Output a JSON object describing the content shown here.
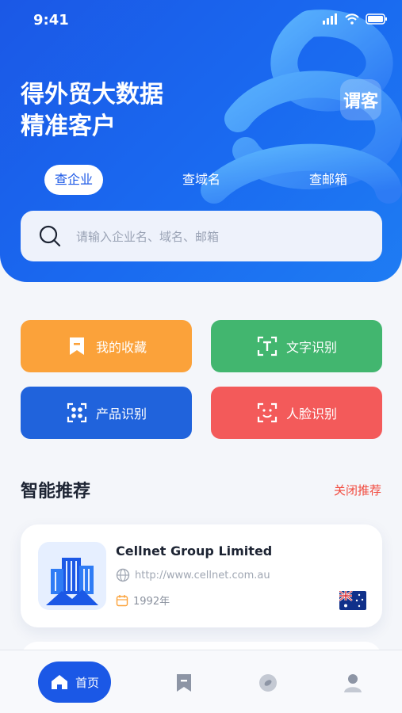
{
  "status": {
    "time": "9:41"
  },
  "hero": {
    "headline_line1": "得外贸大数据",
    "headline_line2": "精准客户",
    "brand_badge": "谓客"
  },
  "search_tabs": [
    {
      "label": "查企业",
      "active": true
    },
    {
      "label": "查域名",
      "active": false
    },
    {
      "label": "查邮箱",
      "active": false
    }
  ],
  "search": {
    "placeholder": "请输入企业名、域名、邮箱",
    "icon": "search-icon"
  },
  "features": [
    {
      "label": "我的收藏",
      "icon": "bookmark-icon",
      "color": "#fba23a"
    },
    {
      "label": "文字识别",
      "icon": "text-scan-icon",
      "color": "#42b66f"
    },
    {
      "label": "产品识别",
      "icon": "product-scan-icon",
      "color": "#2063dc"
    },
    {
      "label": "人脸识别",
      "icon": "face-scan-icon",
      "color": "#f35a5a"
    }
  ],
  "recommend": {
    "title": "智能推荐",
    "close_label": "关闭推荐",
    "items": [
      {
        "name": "Cellnet Group Limited",
        "url": "http://www.cellnet.com.au",
        "year": "1992年",
        "flag": "australia-flag"
      }
    ]
  },
  "tabbar": {
    "home_label": "首页",
    "items": [
      "home-icon",
      "bookmark-icon",
      "discover-icon",
      "profile-icon"
    ]
  },
  "colors": {
    "primary": "#1b58e6",
    "accent_red": "#f24b3f"
  }
}
